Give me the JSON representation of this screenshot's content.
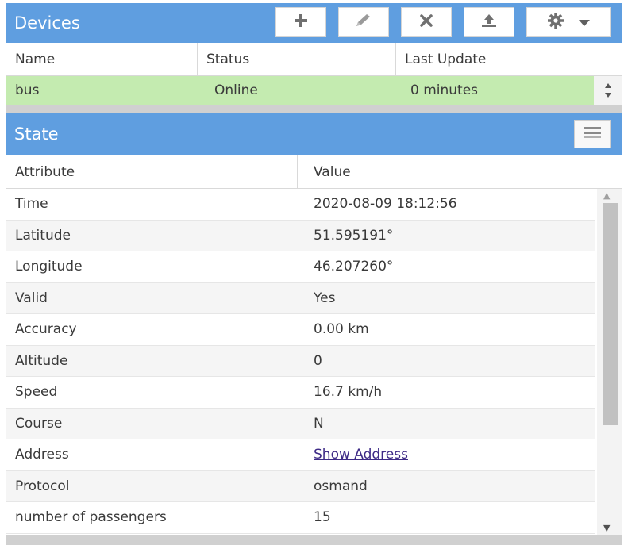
{
  "devices": {
    "title": "Devices",
    "toolbar": {
      "add_icon": "plus-icon",
      "edit_icon": "pencil-icon",
      "remove_icon": "x-icon",
      "command_icon": "upload-icon",
      "settings_icon": "gear-icon"
    },
    "columns": [
      "Name",
      "Status",
      "Last Update"
    ],
    "rows": [
      {
        "name": "bus",
        "status": "Online",
        "last_update": "0 minutes"
      }
    ],
    "selected_row_color": "#c4ebb0"
  },
  "state": {
    "title": "State",
    "columns": [
      "Attribute",
      "Value"
    ],
    "rows": [
      {
        "attribute": "Time",
        "value": "2020-08-09 18:12:56"
      },
      {
        "attribute": "Latitude",
        "value": "51.595191°"
      },
      {
        "attribute": "Longitude",
        "value": "46.207260°"
      },
      {
        "attribute": "Valid",
        "value": "Yes"
      },
      {
        "attribute": "Accuracy",
        "value": "0.00 km"
      },
      {
        "attribute": "Altitude",
        "value": "0"
      },
      {
        "attribute": "Speed",
        "value": "16.7 km/h"
      },
      {
        "attribute": "Course",
        "value": "N"
      },
      {
        "attribute": "Address",
        "value": "Show Address"
      },
      {
        "attribute": "Protocol",
        "value": "osmand"
      },
      {
        "attribute": "number of passengers",
        "value": "15"
      }
    ]
  },
  "colors": {
    "header": "#5f9ee0",
    "link": "#3d2a86"
  }
}
